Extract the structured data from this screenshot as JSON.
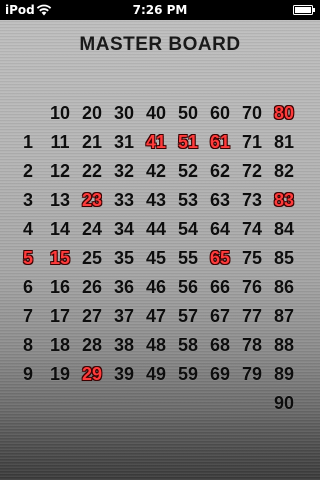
{
  "status_bar": {
    "device": "iPod",
    "time": "7:26 PM",
    "wifi_icon": "wifi-icon",
    "battery_icon": "battery-icon"
  },
  "board": {
    "title": "MASTER BOARD",
    "numbers_max": 90,
    "called_numbers": [
      5,
      15,
      23,
      29,
      41,
      51,
      61,
      65,
      80,
      83
    ],
    "called_color": "#ff3b3b",
    "default_color": "#0d0d0d"
  }
}
